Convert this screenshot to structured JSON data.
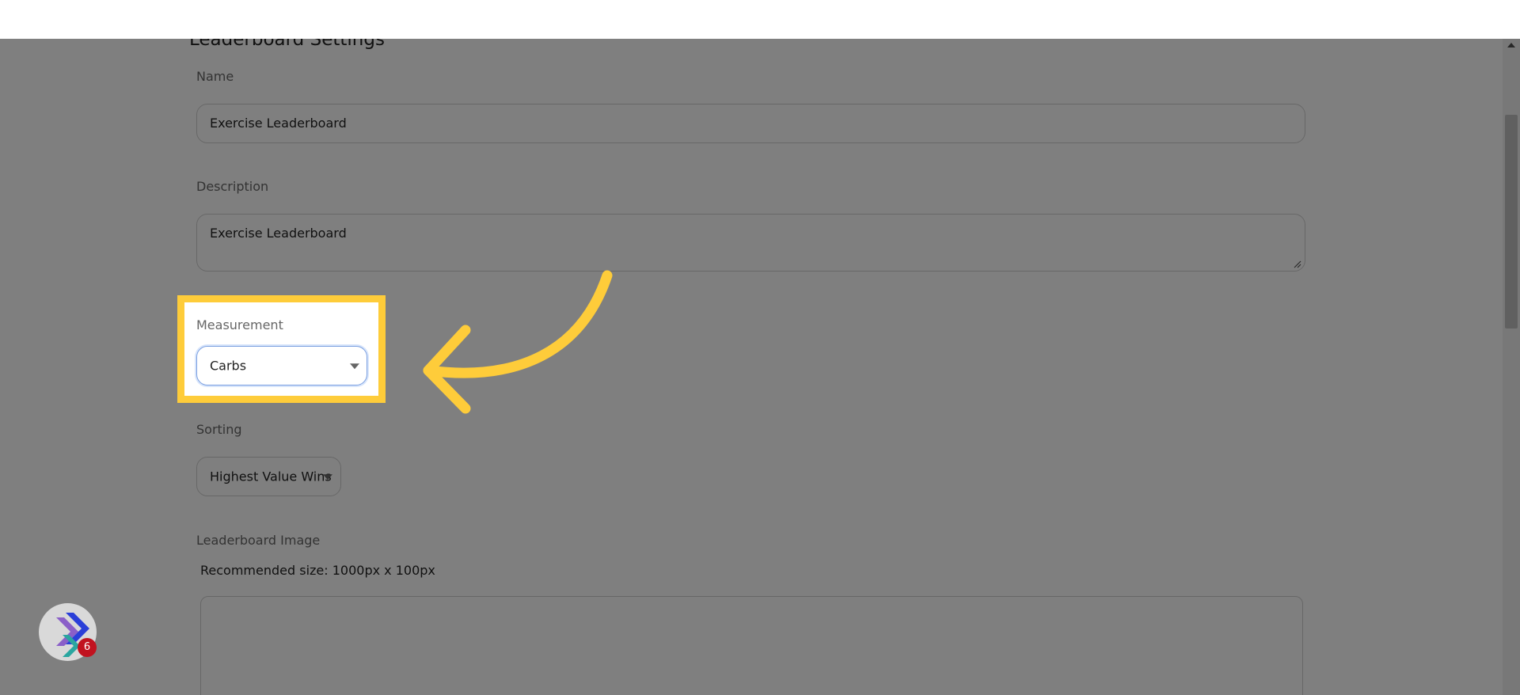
{
  "page": {
    "title": "Leaderboard Settings"
  },
  "form": {
    "name": {
      "label": "Name",
      "value": "Exercise Leaderboard"
    },
    "description": {
      "label": "Description",
      "value": "Exercise Leaderboard"
    },
    "measurement": {
      "label": "Measurement",
      "selected": "Carbs"
    },
    "sorting": {
      "label": "Sorting",
      "selected": "Highest Value Wins"
    },
    "leaderboard_image": {
      "label": "Leaderboard Image",
      "recommended": "Recommended size: 1000px x 100px"
    }
  },
  "overlay": {
    "highlight_color": "#FECC3A",
    "dim_color": "#000000",
    "arrow_icon": "curved-arrow-left"
  },
  "widget": {
    "icon": "chevron-logo-icon",
    "badge_count": "6",
    "badge_color": "#C1121F"
  }
}
